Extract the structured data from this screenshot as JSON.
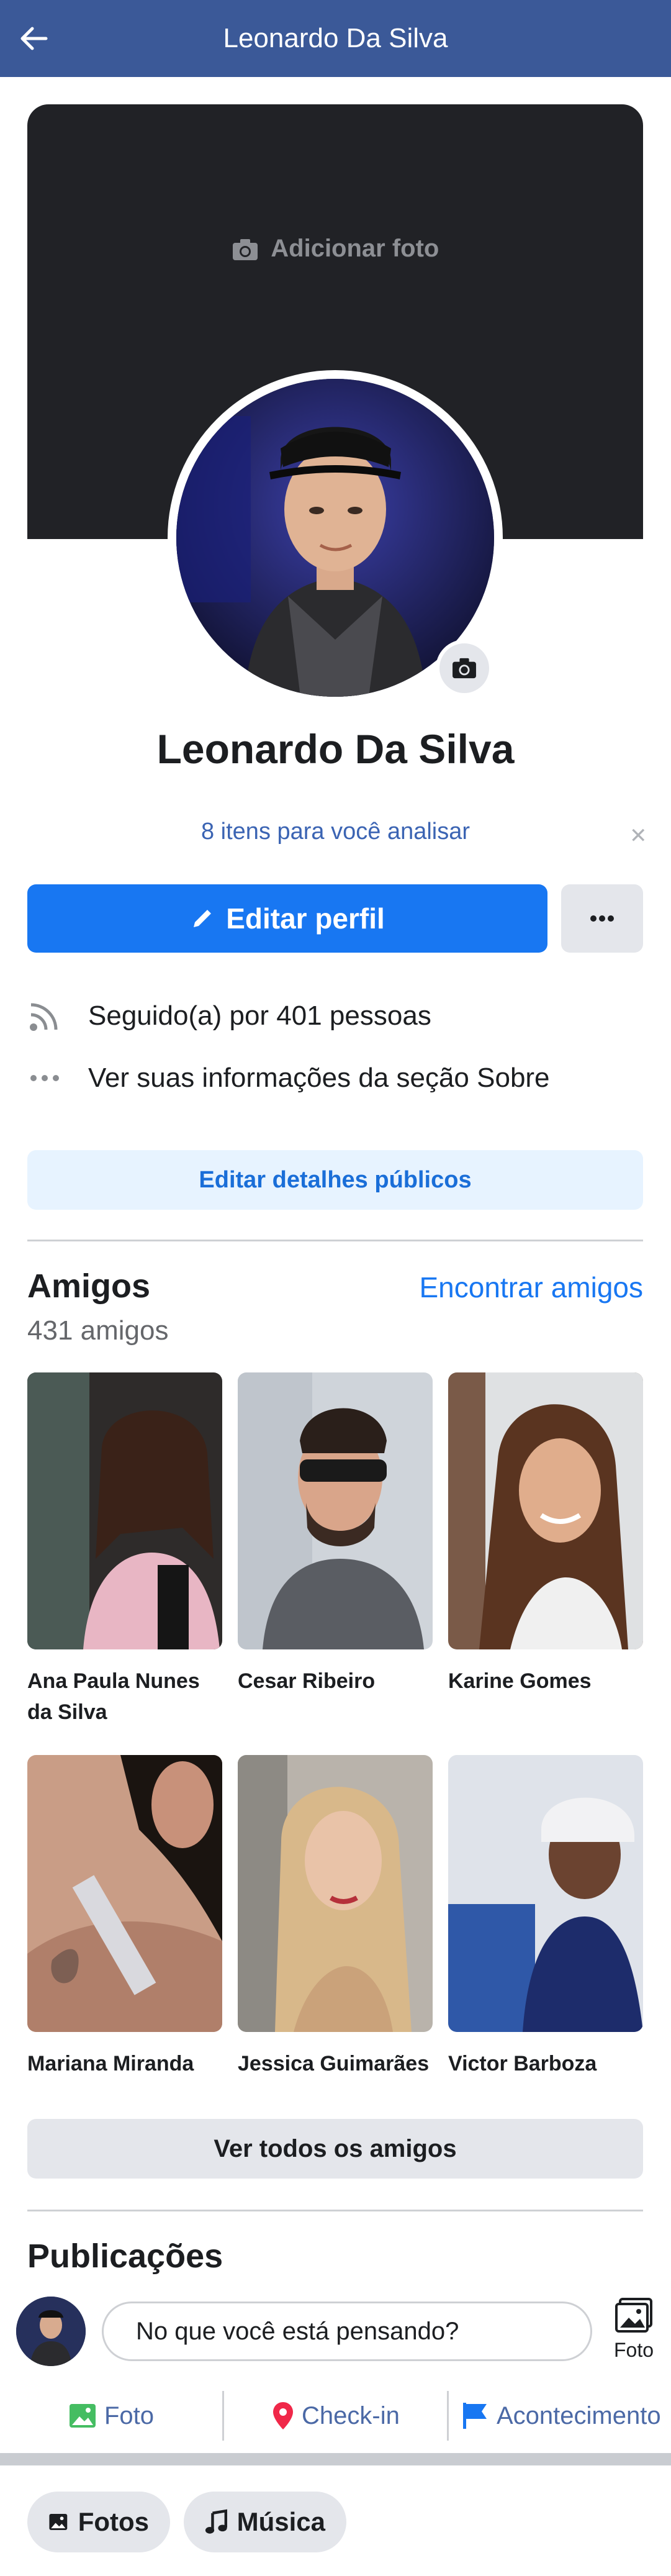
{
  "header": {
    "title": "Leonardo Da Silva",
    "back_icon": "back-arrow-icon"
  },
  "cover": {
    "add_photo_label": "Adicionar foto"
  },
  "profile": {
    "name": "Leonardo Da Silva",
    "review_link": "8 itens para você analisar",
    "edit_profile_label": "Editar perfil",
    "followed_by": "Seguido(a) por 401 pessoas",
    "about_link": "Ver suas informações da seção Sobre",
    "edit_public_details_label": "Editar detalhes públicos"
  },
  "friends": {
    "title": "Amigos",
    "count": "431 amigos",
    "find_friends_label": "Encontrar amigos",
    "see_all_label": "Ver todos os amigos",
    "items": [
      {
        "name": "Ana Paula Nunes da Silva"
      },
      {
        "name": "Cesar Ribeiro"
      },
      {
        "name": "Karine Gomes"
      },
      {
        "name": "Mariana Miranda"
      },
      {
        "name": "Jessica Guimarães"
      },
      {
        "name": "Victor Barboza"
      }
    ]
  },
  "posts": {
    "title": "Publicações",
    "composer_placeholder": "No que você está pensando?",
    "photo_button_label": "Foto",
    "actions": [
      {
        "label": "Foto",
        "icon": "photo-icon",
        "color": "#45bd62"
      },
      {
        "label": "Check-in",
        "icon": "location-pin-icon",
        "color": "#f02849"
      },
      {
        "label": "Acontecimento",
        "icon": "flag-icon",
        "color": "#1877f2"
      }
    ]
  },
  "chips": [
    {
      "label": "Fotos",
      "icon": "photos-icon"
    },
    {
      "label": "Música",
      "icon": "music-note-icon"
    }
  ],
  "colors": {
    "header_bg": "#3b5998",
    "primary": "#1877f2",
    "cover_bg": "#212226"
  }
}
